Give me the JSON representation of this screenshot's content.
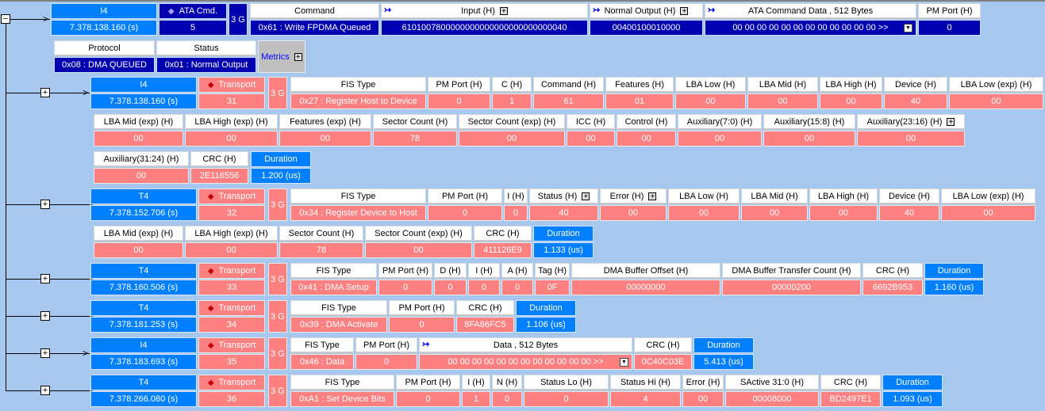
{
  "colors": {
    "background": "#a6c8ee",
    "timestamp": "#0080ff",
    "command": "#0000b0",
    "fis": "#ff8080",
    "metrics": "#c0c0c0"
  },
  "command": {
    "time_label": "I4",
    "time": "7.378.138.160 (s)",
    "cmd_label": "ATA Cmd.",
    "cmd_value": "5",
    "speed": "3 G",
    "fields": [
      {
        "h": "Command",
        "v": "0x61 : Write FPDMA Queued"
      },
      {
        "h": "Input (H)",
        "v": "6101007800000000000000000000000040",
        "arrow": true,
        "expand": true
      },
      {
        "h": "Normal Output (H)",
        "v": "00400100010000",
        "arrow": true,
        "expand": true
      },
      {
        "h": "ATA Command Data , 512 Bytes",
        "v": "00 00 00 00 00 00 00 00 00 00 00 00  >>",
        "arrow": true,
        "dropdown": true
      },
      {
        "h": "PM Port (H)",
        "v": "0"
      }
    ],
    "sub": [
      {
        "h": "Protocol",
        "v": "0x08 : DMA QUEUED"
      },
      {
        "h": "Status",
        "v": "0x01 : Normal Output"
      }
    ],
    "metrics": "Metrics"
  },
  "packets": [
    {
      "dir": "right",
      "time_label": "I4",
      "time": "7.378.138.160 (s)",
      "transport": "Transport",
      "transport_value": "31",
      "speed": "3 G",
      "lines": [
        [
          {
            "h": "FIS Type",
            "v": "0x27 : Register Host to Device"
          },
          {
            "h": "PM Port (H)",
            "v": "0"
          },
          {
            "h": "C (H)",
            "v": "1"
          },
          {
            "h": "Command (H)",
            "v": "61"
          },
          {
            "h": "Features (H)",
            "v": "01"
          },
          {
            "h": "LBA Low (H)",
            "v": "00"
          },
          {
            "h": "LBA Mid (H)",
            "v": "00"
          },
          {
            "h": "LBA High (H)",
            "v": "00"
          },
          {
            "h": "Device (H)",
            "v": "40"
          },
          {
            "h": "LBA Low (exp) (H)",
            "v": "00"
          }
        ],
        [
          {
            "h": "LBA Mid (exp) (H)",
            "v": "00"
          },
          {
            "h": "LBA High (exp) (H)",
            "v": "00"
          },
          {
            "h": "Features (exp) (H)",
            "v": "00"
          },
          {
            "h": "Sector Count (H)",
            "v": "78"
          },
          {
            "h": "Sector Count (exp) (H)",
            "v": "00"
          },
          {
            "h": "ICC (H)",
            "v": "00"
          },
          {
            "h": "Control (H)",
            "v": "00"
          },
          {
            "h": "Auxiliary(7:0) (H)",
            "v": "00"
          },
          {
            "h": "Auxiliary(15:8) (H)",
            "v": "00"
          },
          {
            "h": "Auxiliary(23:16) (H)",
            "v": "00",
            "expand": true
          }
        ],
        [
          {
            "h": "Auxiliary(31:24) (H)",
            "v": "00"
          },
          {
            "h": "CRC (H)",
            "v": "2E116556"
          },
          {
            "h": "Duration",
            "v": "1.200 (us)"
          }
        ]
      ]
    },
    {
      "dir": "left",
      "time_label": "T4",
      "time": "7.378.152.706 (s)",
      "transport": "Transport",
      "transport_value": "32",
      "speed": "3 G",
      "lines": [
        [
          {
            "h": "FIS Type",
            "v": "0x34 : Register Device to Host"
          },
          {
            "h": "PM Port (H)",
            "v": "0"
          },
          {
            "h": "I (H)",
            "v": "0"
          },
          {
            "h": "Status (H)",
            "v": "40",
            "expand": true
          },
          {
            "h": "Error (H)",
            "v": "00",
            "expand": true
          },
          {
            "h": "LBA Low (H)",
            "v": "00"
          },
          {
            "h": "LBA Mid (H)",
            "v": "00"
          },
          {
            "h": "LBA High (H)",
            "v": "00"
          },
          {
            "h": "Device (H)",
            "v": "40"
          },
          {
            "h": "LBA Low (exp) (H)",
            "v": "00"
          }
        ],
        [
          {
            "h": "LBA Mid (exp) (H)",
            "v": "00"
          },
          {
            "h": "LBA High (exp) (H)",
            "v": "00"
          },
          {
            "h": "Sector Count (H)",
            "v": "78"
          },
          {
            "h": "Sector Count (exp) (H)",
            "v": "00"
          },
          {
            "h": "CRC (H)",
            "v": "411126E9"
          },
          {
            "h": "Duration",
            "v": "1.133 (us)"
          }
        ]
      ]
    },
    {
      "dir": "left",
      "time_label": "T4",
      "time": "7.378.160.506 (s)",
      "transport": "Transport",
      "transport_value": "33",
      "speed": "3 G",
      "lines": [
        [
          {
            "h": "FIS Type",
            "v": "0x41 : DMA Setup"
          },
          {
            "h": "PM Port (H)",
            "v": "0"
          },
          {
            "h": "D (H)",
            "v": "0"
          },
          {
            "h": "I (H)",
            "v": "0"
          },
          {
            "h": "A (H)",
            "v": "0"
          },
          {
            "h": "Tag (H)",
            "v": "0F"
          },
          {
            "h": "DMA Buffer Offset (H)",
            "v": "00000000"
          },
          {
            "h": "DMA Buffer Transfer Count (H)",
            "v": "00000200"
          },
          {
            "h": "CRC (H)",
            "v": "6692B953"
          },
          {
            "h": "Duration",
            "v": "1.160 (us)"
          }
        ]
      ]
    },
    {
      "dir": "left",
      "time_label": "T4",
      "time": "7.378.181.253 (s)",
      "transport": "Transport",
      "transport_value": "34",
      "speed": "3 G",
      "lines": [
        [
          {
            "h": "FIS Type",
            "v": "0x39 : DMA Activate"
          },
          {
            "h": "PM Port (H)",
            "v": "0"
          },
          {
            "h": "CRC (H)",
            "v": "8FA86FC5"
          },
          {
            "h": "Duration",
            "v": "1.106 (us)"
          }
        ]
      ]
    },
    {
      "dir": "right",
      "time_label": "I4",
      "time": "7.378.183.693 (s)",
      "transport": "Transport",
      "transport_value": "35",
      "speed": "3 G",
      "lines": [
        [
          {
            "h": "FIS Type",
            "v": "0x46 : Data"
          },
          {
            "h": "PM Port (H)",
            "v": "0"
          },
          {
            "h": "Data , 512 Bytes",
            "v": "00 00 00 00 00 00 00 00 00 00 00 00  >>",
            "arrow": true,
            "dropdown": true
          },
          {
            "h": "CRC (H)",
            "v": "0C40C03E"
          },
          {
            "h": "Duration",
            "v": "5.413 (us)"
          }
        ]
      ]
    },
    {
      "dir": "left",
      "time_label": "T4",
      "time": "7.378.266.080 (s)",
      "transport": "Transport",
      "transport_value": "36",
      "speed": "3 G",
      "lines": [
        [
          {
            "h": "FIS Type",
            "v": "0xA1 : Set Device Bits"
          },
          {
            "h": "PM Port (H)",
            "v": "0"
          },
          {
            "h": "I (H)",
            "v": "1"
          },
          {
            "h": "N (H)",
            "v": "0"
          },
          {
            "h": "Status Lo (H)",
            "v": "0"
          },
          {
            "h": "Status Hi (H)",
            "v": "4"
          },
          {
            "h": "Error (H)",
            "v": "00"
          },
          {
            "h": "SActive 31:0 (H)",
            "v": "00008000"
          },
          {
            "h": "CRC (H)",
            "v": "BD2497E1"
          },
          {
            "h": "Duration",
            "v": "1.093 (us)"
          }
        ]
      ]
    }
  ]
}
